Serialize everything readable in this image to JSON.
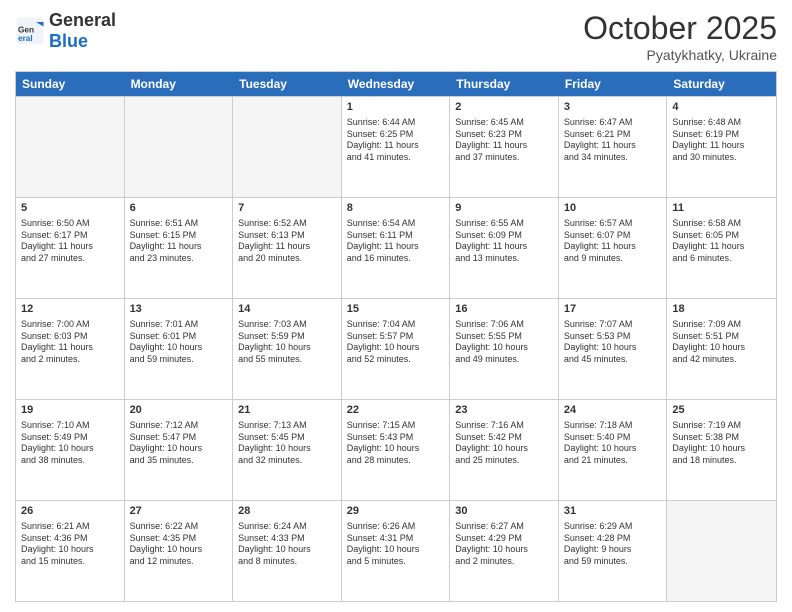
{
  "header": {
    "logo_general": "General",
    "logo_blue": "Blue",
    "title": "October 2025",
    "location": "Pyatykhatky, Ukraine"
  },
  "weekdays": [
    "Sunday",
    "Monday",
    "Tuesday",
    "Wednesday",
    "Thursday",
    "Friday",
    "Saturday"
  ],
  "weeks": [
    [
      {
        "day": "",
        "info": "",
        "empty": true
      },
      {
        "day": "",
        "info": "",
        "empty": true
      },
      {
        "day": "",
        "info": "",
        "empty": true
      },
      {
        "day": "1",
        "info": "Sunrise: 6:44 AM\nSunset: 6:25 PM\nDaylight: 11 hours\nand 41 minutes."
      },
      {
        "day": "2",
        "info": "Sunrise: 6:45 AM\nSunset: 6:23 PM\nDaylight: 11 hours\nand 37 minutes."
      },
      {
        "day": "3",
        "info": "Sunrise: 6:47 AM\nSunset: 6:21 PM\nDaylight: 11 hours\nand 34 minutes."
      },
      {
        "day": "4",
        "info": "Sunrise: 6:48 AM\nSunset: 6:19 PM\nDaylight: 11 hours\nand 30 minutes."
      }
    ],
    [
      {
        "day": "5",
        "info": "Sunrise: 6:50 AM\nSunset: 6:17 PM\nDaylight: 11 hours\nand 27 minutes."
      },
      {
        "day": "6",
        "info": "Sunrise: 6:51 AM\nSunset: 6:15 PM\nDaylight: 11 hours\nand 23 minutes."
      },
      {
        "day": "7",
        "info": "Sunrise: 6:52 AM\nSunset: 6:13 PM\nDaylight: 11 hours\nand 20 minutes."
      },
      {
        "day": "8",
        "info": "Sunrise: 6:54 AM\nSunset: 6:11 PM\nDaylight: 11 hours\nand 16 minutes."
      },
      {
        "day": "9",
        "info": "Sunrise: 6:55 AM\nSunset: 6:09 PM\nDaylight: 11 hours\nand 13 minutes."
      },
      {
        "day": "10",
        "info": "Sunrise: 6:57 AM\nSunset: 6:07 PM\nDaylight: 11 hours\nand 9 minutes."
      },
      {
        "day": "11",
        "info": "Sunrise: 6:58 AM\nSunset: 6:05 PM\nDaylight: 11 hours\nand 6 minutes."
      }
    ],
    [
      {
        "day": "12",
        "info": "Sunrise: 7:00 AM\nSunset: 6:03 PM\nDaylight: 11 hours\nand 2 minutes."
      },
      {
        "day": "13",
        "info": "Sunrise: 7:01 AM\nSunset: 6:01 PM\nDaylight: 10 hours\nand 59 minutes."
      },
      {
        "day": "14",
        "info": "Sunrise: 7:03 AM\nSunset: 5:59 PM\nDaylight: 10 hours\nand 55 minutes."
      },
      {
        "day": "15",
        "info": "Sunrise: 7:04 AM\nSunset: 5:57 PM\nDaylight: 10 hours\nand 52 minutes."
      },
      {
        "day": "16",
        "info": "Sunrise: 7:06 AM\nSunset: 5:55 PM\nDaylight: 10 hours\nand 49 minutes."
      },
      {
        "day": "17",
        "info": "Sunrise: 7:07 AM\nSunset: 5:53 PM\nDaylight: 10 hours\nand 45 minutes."
      },
      {
        "day": "18",
        "info": "Sunrise: 7:09 AM\nSunset: 5:51 PM\nDaylight: 10 hours\nand 42 minutes."
      }
    ],
    [
      {
        "day": "19",
        "info": "Sunrise: 7:10 AM\nSunset: 5:49 PM\nDaylight: 10 hours\nand 38 minutes."
      },
      {
        "day": "20",
        "info": "Sunrise: 7:12 AM\nSunset: 5:47 PM\nDaylight: 10 hours\nand 35 minutes."
      },
      {
        "day": "21",
        "info": "Sunrise: 7:13 AM\nSunset: 5:45 PM\nDaylight: 10 hours\nand 32 minutes."
      },
      {
        "day": "22",
        "info": "Sunrise: 7:15 AM\nSunset: 5:43 PM\nDaylight: 10 hours\nand 28 minutes."
      },
      {
        "day": "23",
        "info": "Sunrise: 7:16 AM\nSunset: 5:42 PM\nDaylight: 10 hours\nand 25 minutes."
      },
      {
        "day": "24",
        "info": "Sunrise: 7:18 AM\nSunset: 5:40 PM\nDaylight: 10 hours\nand 21 minutes."
      },
      {
        "day": "25",
        "info": "Sunrise: 7:19 AM\nSunset: 5:38 PM\nDaylight: 10 hours\nand 18 minutes."
      }
    ],
    [
      {
        "day": "26",
        "info": "Sunrise: 6:21 AM\nSunset: 4:36 PM\nDaylight: 10 hours\nand 15 minutes."
      },
      {
        "day": "27",
        "info": "Sunrise: 6:22 AM\nSunset: 4:35 PM\nDaylight: 10 hours\nand 12 minutes."
      },
      {
        "day": "28",
        "info": "Sunrise: 6:24 AM\nSunset: 4:33 PM\nDaylight: 10 hours\nand 8 minutes."
      },
      {
        "day": "29",
        "info": "Sunrise: 6:26 AM\nSunset: 4:31 PM\nDaylight: 10 hours\nand 5 minutes."
      },
      {
        "day": "30",
        "info": "Sunrise: 6:27 AM\nSunset: 4:29 PM\nDaylight: 10 hours\nand 2 minutes."
      },
      {
        "day": "31",
        "info": "Sunrise: 6:29 AM\nSunset: 4:28 PM\nDaylight: 9 hours\nand 59 minutes."
      },
      {
        "day": "",
        "info": "",
        "empty": true
      }
    ]
  ]
}
